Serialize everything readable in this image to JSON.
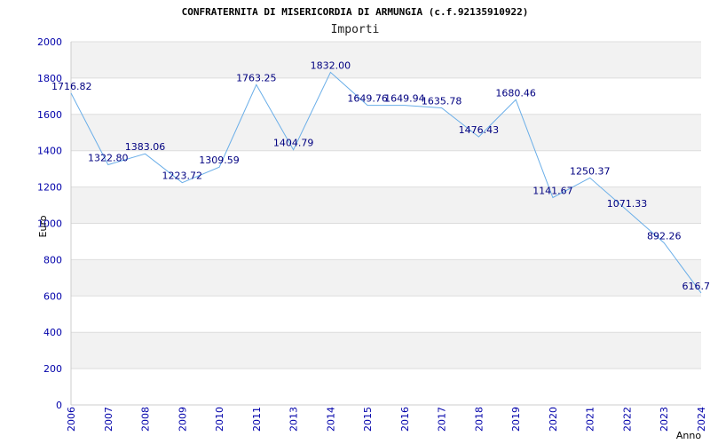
{
  "chart_data": {
    "type": "line",
    "title": "CONFRATERNITA DI MISERICORDIA DI ARMUNGIA (c.f.92135910922)",
    "subtitle": "Importi",
    "xlabel": "Anno",
    "ylabel": "Euro",
    "ylim": [
      0,
      2000
    ],
    "yticks": [
      0,
      200,
      400,
      600,
      800,
      1000,
      1200,
      1400,
      1600,
      1800,
      2000
    ],
    "grid": true,
    "categories": [
      "2006",
      "2007",
      "2008",
      "2009",
      "2010",
      "2011",
      "2013",
      "2014",
      "2015",
      "2016",
      "2017",
      "2018",
      "2019",
      "2020",
      "2021",
      "2022",
      "2023",
      "2024"
    ],
    "series": [
      {
        "values": [
          1716.82,
          1322.8,
          1383.06,
          1223.72,
          1309.59,
          1763.25,
          1404.79,
          1832.0,
          1649.76,
          1649.94,
          1635.78,
          1476.43,
          1680.46,
          1141.67,
          1250.37,
          1071.33,
          892.26,
          616.7
        ],
        "labels": [
          "1716.82",
          "1322.80",
          "1383.06",
          "1223.72",
          "1309.59",
          "1763.25",
          "1404.79",
          "1832.00",
          "1649.76",
          "1649.94",
          "1635.78",
          "1476.43",
          "1680.46",
          "1141.67",
          "1250.37",
          "1071.33",
          "892.26",
          "616.7"
        ]
      }
    ],
    "colors": {
      "line": "#6aaee8",
      "band": "#f2f2f2",
      "grid": "#dddddd",
      "tick_text": "#0000aa",
      "value_text": "#000080"
    }
  }
}
